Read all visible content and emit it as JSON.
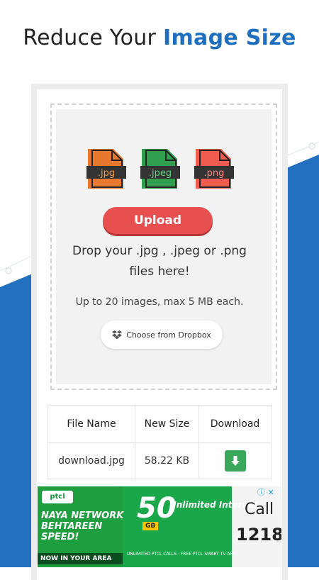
{
  "headline": {
    "prefix": "Reduce Your",
    "accent": "Image Size"
  },
  "file_types": [
    {
      "label": ".jpg",
      "color": "#e8782e"
    },
    {
      "label": ".jpeg",
      "color": "#2f9e4f"
    },
    {
      "label": ".png",
      "color": "#ef5b4e"
    }
  ],
  "upload": {
    "button_label": "Upload"
  },
  "dropzone": {
    "text_line1": "Drop your .jpg , .jpeg or .png",
    "text_line2": "files here!",
    "limit_text": "Up to 20 images, max 5 MB each.",
    "dropbox_label": "Choose from Dropbox"
  },
  "table": {
    "headers": [
      "File Name",
      "New Size",
      "Download"
    ],
    "rows": [
      {
        "file_name": "download.jpg",
        "new_size": "58.22 KB"
      }
    ]
  },
  "ad": {
    "brand": "ptcl",
    "headline": "NAYA NETWORK BEHTAREEN SPEED!",
    "strip": "NOW IN YOUR AREA",
    "big_number": "50",
    "unit": "GB",
    "offer": "Unlimited Internet",
    "footnote": "UNLIMITED PTCL CALLS · FREE PTCL SMART TV APP",
    "call_label": "Call",
    "call_number": "1218"
  },
  "colors": {
    "accent_blue": "#1f6fc0",
    "upload_red": "#e84f4f",
    "download_green": "#3aa85a"
  }
}
